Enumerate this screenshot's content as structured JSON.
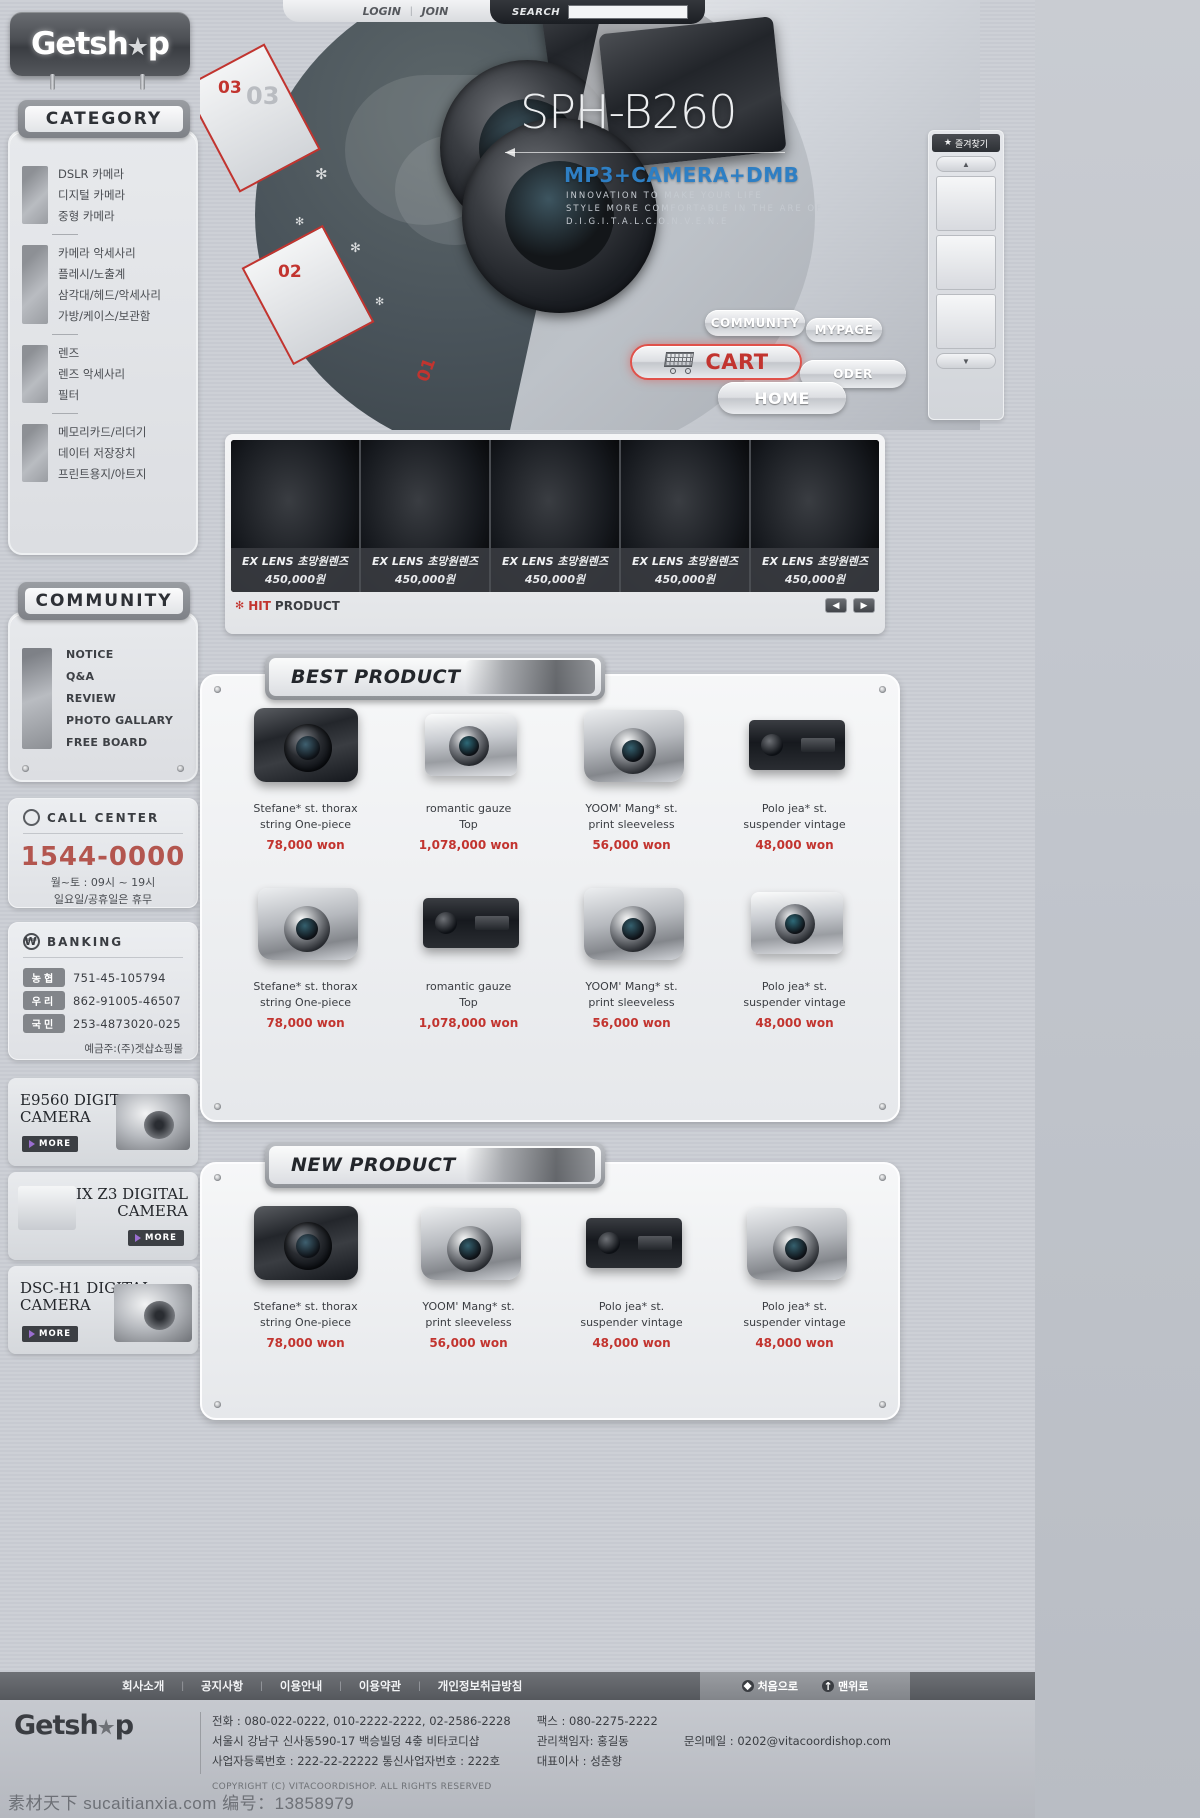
{
  "brand": {
    "name_pre": "Getsh",
    "name_post": "p",
    "star_icon": "star-icon"
  },
  "topbar": {
    "login": "LOGIN",
    "join": "JOIN",
    "separator": "|"
  },
  "search": {
    "label": "SEARCH",
    "value": "",
    "placeholder": ""
  },
  "hero": {
    "title_main": "SPH",
    "title_sub": "-B260",
    "subtitle": "MP3+CAMERA+DMB",
    "desc_line1": "INNOVATION TO MAKE YOUR LIFE",
    "desc_line2": "STYLE MORE COMFORTABLE IN THE ARE OF",
    "desc_line3": "D.I.G.I.T.A.L.C.O.N.V.E.N.E",
    "film_numbers": [
      "03",
      "02",
      "01"
    ],
    "film_ghost": "03"
  },
  "nav_buttons": [
    {
      "label": "COMMUNITY",
      "name": "community-button"
    },
    {
      "label": "MYPAGE",
      "name": "mypage-button"
    },
    {
      "label": "CART",
      "name": "cart-button"
    },
    {
      "label": "ODER",
      "name": "order-button"
    },
    {
      "label": "HOME",
      "name": "home-button"
    }
  ],
  "favorites": {
    "title": "즐겨찾기",
    "star": "★",
    "up_arrow": "▲",
    "down_arrow": "▼",
    "slots": [
      "",
      "",
      ""
    ]
  },
  "sidebar": {
    "category": {
      "header": "CATEGORY",
      "groups": [
        {
          "thumb": "dslr-camera-thumb",
          "items": [
            "DSLR 카메라",
            "디지털 카메라",
            "중형 카메라"
          ]
        },
        {
          "thumb": "tripod-thumb",
          "items": [
            "카메라 악세사리",
            "플레시/노출계",
            "삼각대/헤드/악세사리",
            "가방/케이스/보관함"
          ]
        },
        {
          "thumb": "lens-thumb",
          "items": [
            "렌즈",
            "렌즈 악세사리",
            "필터"
          ]
        },
        {
          "thumb": "memory-card-thumb",
          "items": [
            "메모리카드/리더기",
            "데이터 저장장치",
            "프린트용지/아트지"
          ]
        }
      ]
    },
    "community": {
      "header": "COMMUNITY",
      "items": [
        "NOTICE",
        "Q&A",
        "REVIEW",
        "PHOTO GALLARY",
        "FREE BOARD"
      ]
    },
    "call_center": {
      "title": "CALL CENTER",
      "phone": "1544-0000",
      "hours_line1": "월~토 : 09시 ~ 19시",
      "hours_line2": "일요일/공휴일은 휴무"
    },
    "banking": {
      "title": "BANKING",
      "accounts": [
        {
          "bank": "농협",
          "number": "751-45-105794"
        },
        {
          "bank": "우리",
          "number": "862-91005-46507"
        },
        {
          "bank": "국민",
          "number": "253-4873020-025"
        }
      ],
      "owner": "예금주:(주)겟샵쇼핑몰"
    },
    "banners": [
      {
        "title_line1": "E9560 DIGITAL",
        "title_line2": "CAMERA",
        "more": "MORE"
      },
      {
        "title_line1": "PIX Z3 DIGITAL",
        "title_line2": "CAMERA",
        "more": "MORE"
      },
      {
        "title_line1": "DSC-H1 DIGITAL",
        "title_line2": "CAMERA",
        "more": "MORE"
      }
    ]
  },
  "hit_product": {
    "label_red": "HIT",
    "label_rest": "PRODUCT",
    "prev": "◀",
    "next": "▶",
    "items": [
      {
        "name": "EX LENS 초망원렌즈",
        "price": "450,000원"
      },
      {
        "name": "EX LENS 초망원렌즈",
        "price": "450,000원"
      },
      {
        "name": "EX LENS 초망원렌즈",
        "price": "450,000원"
      },
      {
        "name": "EX LENS 초망원렌즈",
        "price": "450,000원"
      },
      {
        "name": "EX LENS 초망원렌즈",
        "price": "450,000원"
      }
    ]
  },
  "best_product": {
    "header": "BEST PRODUCT",
    "items": [
      {
        "name_line1": "Stefane* st. thorax",
        "name_line2": "string One-piece",
        "price": "78,000 won",
        "art": "camA"
      },
      {
        "name_line1": "romantic gauze",
        "name_line2": "Top",
        "price": "1,078,000 won",
        "art": "camB"
      },
      {
        "name_line1": "YOOM' Mang* st.",
        "name_line2": "print sleeveless",
        "price": "56,000 won",
        "art": "camD"
      },
      {
        "name_line1": "Polo jea* st.",
        "name_line2": "suspender vintage",
        "price": "48,000 won",
        "art": "camC"
      },
      {
        "name_line1": "Stefane* st. thorax",
        "name_line2": "string One-piece",
        "price": "78,000 won",
        "art": "camD"
      },
      {
        "name_line1": "romantic gauze",
        "name_line2": "Top",
        "price": "1,078,000 won",
        "art": "camC"
      },
      {
        "name_line1": "YOOM' Mang* st.",
        "name_line2": "print sleeveless",
        "price": "56,000 won",
        "art": "camD"
      },
      {
        "name_line1": "Polo jea* st.",
        "name_line2": "suspender vintage",
        "price": "48,000 won",
        "art": "camB"
      }
    ]
  },
  "new_product": {
    "header": "NEW PRODUCT",
    "items": [
      {
        "name_line1": "Stefane* st. thorax",
        "name_line2": "string One-piece",
        "price": "78,000 won",
        "art": "camA"
      },
      {
        "name_line1": "YOOM' Mang* st.",
        "name_line2": "print sleeveless",
        "price": "56,000 won",
        "art": "camD"
      },
      {
        "name_line1": "Polo jea* st.",
        "name_line2": "suspender vintage",
        "price": "48,000 won",
        "art": "camC"
      },
      {
        "name_line1": "Polo jea* st.",
        "name_line2": "suspender vintage",
        "price": "48,000 won",
        "art": "camD"
      }
    ]
  },
  "footer": {
    "links": [
      "회사소개",
      "공지사항",
      "이용안내",
      "이용약관",
      "개인정보취급방침"
    ],
    "top_link": "처음으로",
    "up_link": "맨위로",
    "logo_pre": "Getsh",
    "logo_post": "p",
    "col1": [
      "전화 : 080-022-0222,  010-2222-2222,  02-2586-2228",
      "서울시 강남구 신사동590-17 백승빌덩 4츻 비타코디샵",
      "사업자등록번호 : 222-22-22222    통신사업자번호 : 222호"
    ],
    "col2": [
      "팩스 : 080-2275-2222",
      "관리책임자: 홍길동",
      "대표이사 : 성춘향"
    ],
    "col3": [
      "",
      "문의메일 : 0202@vitacoordishop.com",
      ""
    ],
    "copyright": "COPYRIGHT (C) VITACOORDISHOP. ALL RIGHTS RESERVED"
  },
  "watermark": "素材天下 sucaitianxia.com  编号：13858979",
  "colors": {
    "accent_red": "#c2342f",
    "blue": "#2e7fc4",
    "dark": "#3a3d42"
  }
}
